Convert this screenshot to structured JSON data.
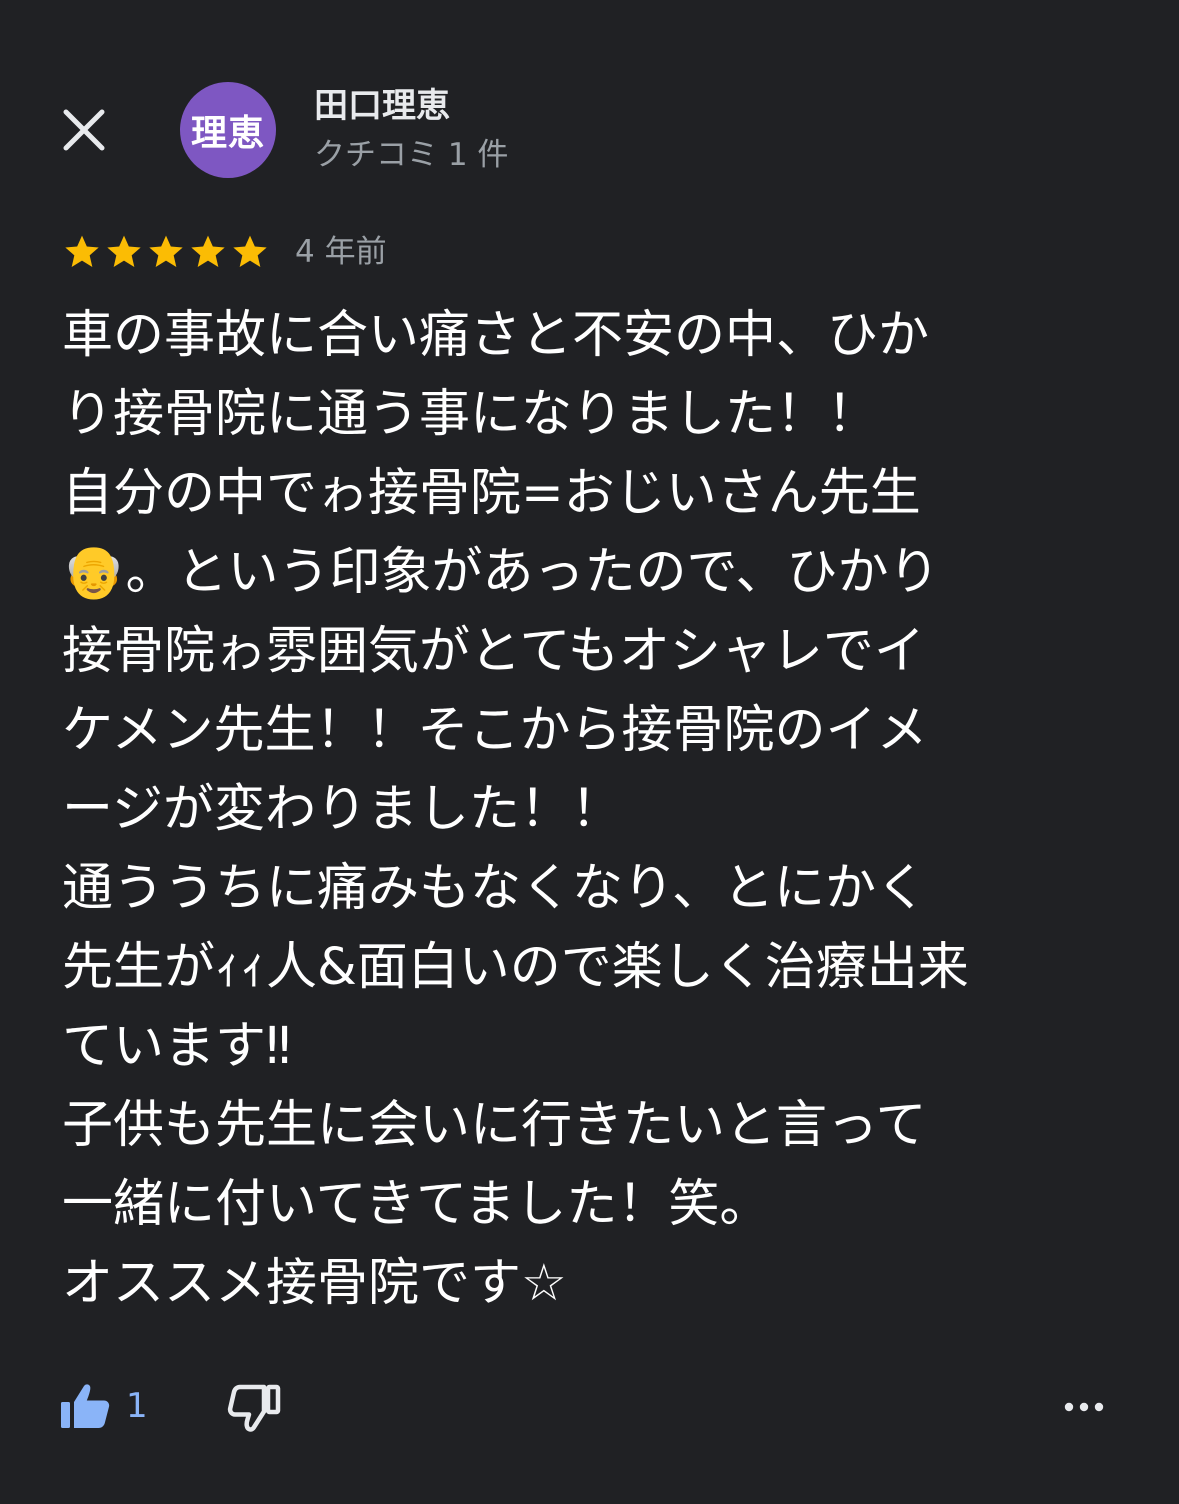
{
  "header": {
    "close_icon": "close-icon",
    "avatar_text": "理恵",
    "avatar_color": "#7e57c2",
    "author_name": "田口理恵",
    "review_count": "クチコミ 1 件"
  },
  "rating": {
    "stars": 5,
    "max_stars": 5,
    "star_color": "#fbbc04",
    "date": "4 年前"
  },
  "review": {
    "lines": [
      "車の事故に合い痛さと不安の中、ひか",
      "り接骨院に通う事になりました！！",
      "自分の中でゎ接骨院=おじいさん先生",
      "👴。という印象があったので、ひかり",
      "接骨院ゎ雰囲気がとてもオシャレでイ",
      "ケメン先生！！そこから接骨院のイメ",
      "ージが変わりました！！",
      "通ううちに痛みもなくなり、とにかく",
      "先生がｨｨ人&面白いので楽しく治療出来",
      "ています‼",
      "子供も先生に会いに行きたいと言って",
      "一緒に付いてきてました！笑。",
      "オススメ接骨院です☆"
    ]
  },
  "actions": {
    "like_icon": "thumbs-up-icon",
    "like_count": "1",
    "dislike_icon": "thumbs-down-icon",
    "more_icon": "more-horizontal-icon",
    "accent_color": "#8ab4f8"
  }
}
